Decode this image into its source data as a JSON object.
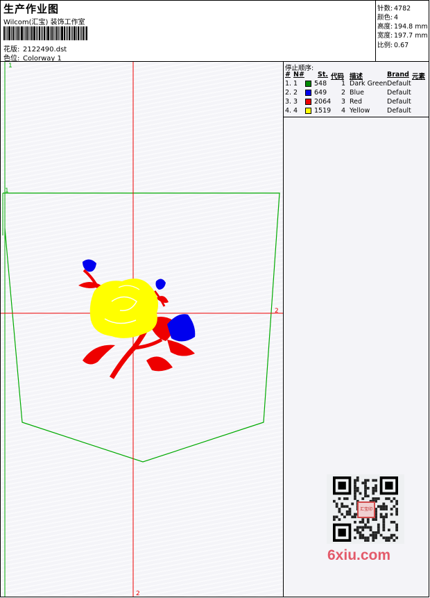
{
  "header": {
    "title": "生产作业图",
    "subtitle": "Wilcom(汇宝) 装饰工作室",
    "design_label": "花版:",
    "design_value": "2122490.dst",
    "colorway_label": "色位:",
    "colorway_value": "Colorway 1"
  },
  "stats": [
    {
      "label": "针数:",
      "value": "4782"
    },
    {
      "label": "颜色:",
      "value": "4"
    },
    {
      "label": "高度:",
      "value": "194.8 mm"
    },
    {
      "label": "宽度:",
      "value": "197.7 mm"
    },
    {
      "label": "比例:",
      "value": "0.67"
    }
  ],
  "stop_sequence": {
    "title": "停止顺序:",
    "headers": {
      "num": "#",
      "needle": "N#",
      "stitches": "St.",
      "code": "代码",
      "desc": "描述",
      "brand": "Brand",
      "elem": "元素"
    },
    "rows": [
      {
        "num": "1.",
        "needle": "1",
        "color": "#008a00",
        "stitches": "548",
        "code": "1",
        "desc": "Dark Green",
        "brand": "Default"
      },
      {
        "num": "2.",
        "needle": "2",
        "color": "#0000ee",
        "stitches": "649",
        "code": "2",
        "desc": "Blue",
        "brand": "Default"
      },
      {
        "num": "3.",
        "needle": "3",
        "color": "#ee0000",
        "stitches": "2064",
        "code": "3",
        "desc": "Red",
        "brand": "Default"
      },
      {
        "num": "4.",
        "needle": "4",
        "color": "#ffff00",
        "stitches": "1519",
        "code": "4",
        "desc": "Yellow",
        "brand": "Default"
      }
    ]
  },
  "canvas": {
    "guide_labels": {
      "top_left": "1",
      "mid_left": "1",
      "right": "2",
      "bottom": "2"
    },
    "guide_color": "#ee0000",
    "pocket_color": "#00aa00"
  },
  "watermark": {
    "text": "6xiu.com",
    "seal_text": "汇宝印",
    "color": "#e35a6a"
  }
}
